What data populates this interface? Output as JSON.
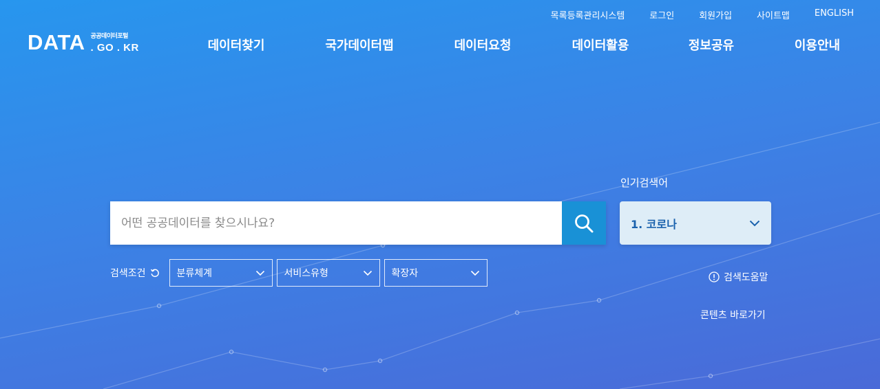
{
  "utility_nav": [
    "목록등록관리시스템",
    "로그인",
    "회원가입",
    "사이트맵",
    "ENGLISH"
  ],
  "logo": {
    "main": "DATA",
    "sub": "공공데이터포털",
    "domain": ". GO . KR"
  },
  "main_nav": [
    "데이터찾기",
    "국가데이터맵",
    "데이터요청",
    "데이터활용",
    "정보공유",
    "이용안내"
  ],
  "search": {
    "placeholder": "어떤 공공데이터를 찾으시나요?"
  },
  "popular": {
    "label": "인기검색어",
    "selected": "1. 코로나"
  },
  "filters": {
    "label": "검색조건",
    "options": [
      "분류체계",
      "서비스유형",
      "확장자"
    ]
  },
  "help_link": "검색도움말",
  "contents_link": "콘텐츠 바로가기",
  "colors": {
    "search_button": "#1991d6",
    "popular_bg": "#deedf7",
    "popular_text": "#1a62ad"
  },
  "icons": {
    "search": "search-icon",
    "reset": "reset-icon",
    "chevron": "chevron-down-icon",
    "info": "info-icon"
  }
}
